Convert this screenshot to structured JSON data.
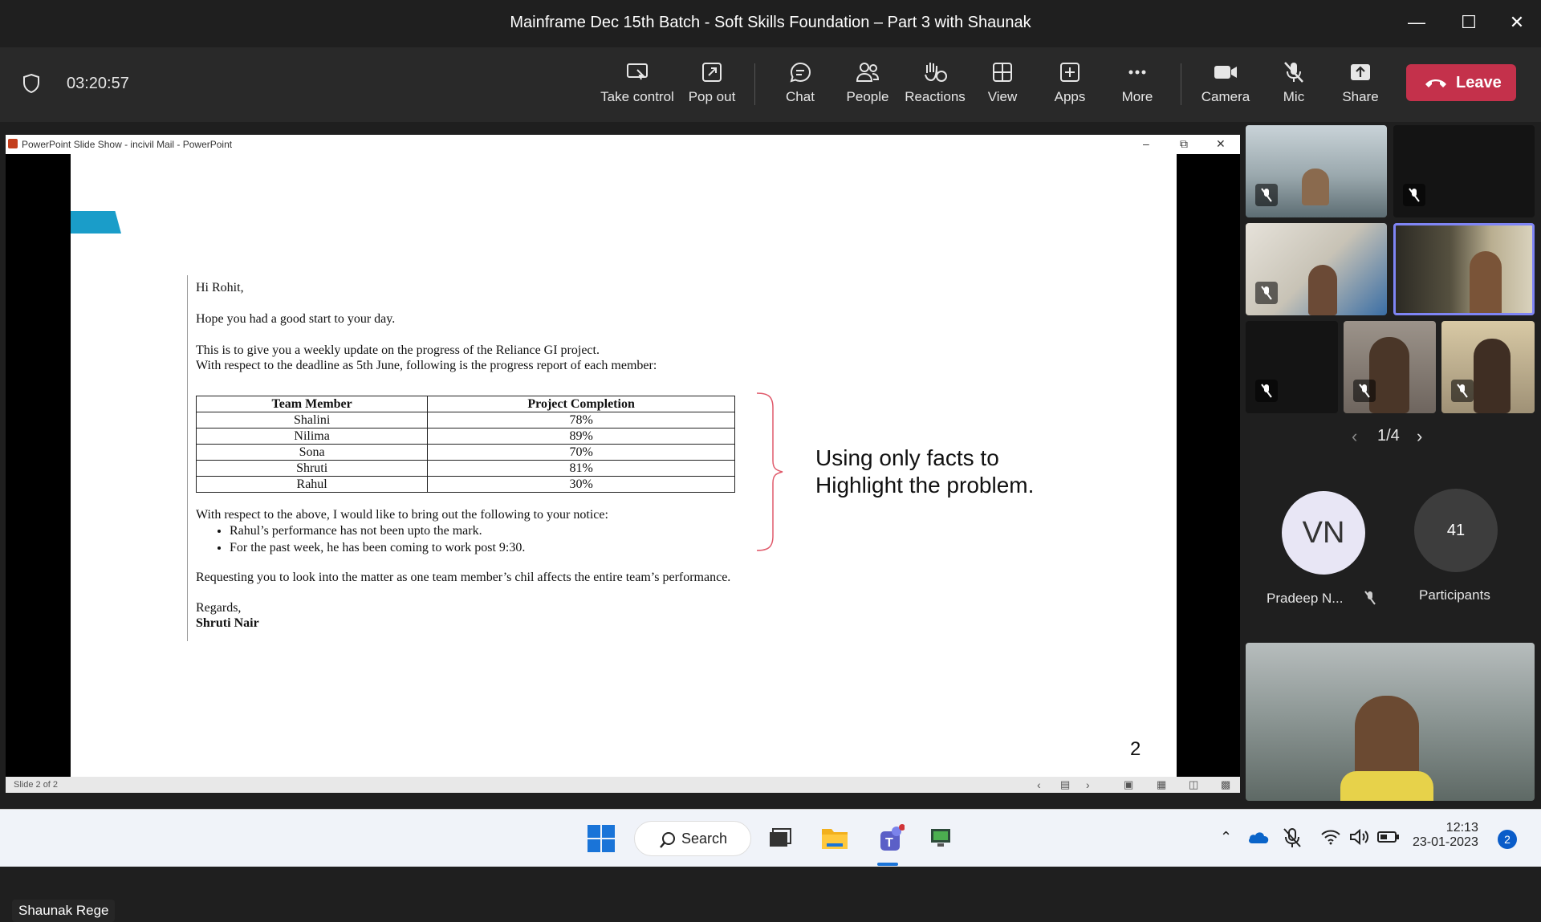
{
  "window": {
    "title": "Mainframe Dec 15th Batch - Soft Skills Foundation – Part 3 with  Shaunak"
  },
  "meeting": {
    "timer": "03:20:57",
    "controls": {
      "take_control": "Take control",
      "pop_out": "Pop out",
      "chat": "Chat",
      "people": "People",
      "reactions": "Reactions",
      "view": "View",
      "apps": "Apps",
      "more": "More",
      "camera": "Camera",
      "mic": "Mic",
      "share": "Share",
      "leave": "Leave"
    },
    "pager": "1/4",
    "spotlight_initials": "VN",
    "spotlight_name": "Pradeep N...",
    "participants_count": "41",
    "participants_label": "Participants",
    "presenter_name": "Shaunak Rege"
  },
  "powerpoint": {
    "window_title": "PowerPoint Slide Show  -  incivil Mail - PowerPoint",
    "status": "Slide 2 of 2"
  },
  "slide": {
    "greeting": "Hi Rohit,",
    "line1": "Hope you had a good start to your day.",
    "line2": "This is to give you a weekly update on the progress of the Reliance GI project.",
    "line3": "With respect to the deadline as 5th June, following is the progress report of each member:",
    "table": {
      "headers": [
        "Team Member",
        "Project Completion"
      ],
      "rows": [
        [
          "Shalini",
          "78%"
        ],
        [
          "Nilima",
          "89%"
        ],
        [
          "Sona",
          "70%"
        ],
        [
          "Shruti",
          "81%"
        ],
        [
          "Rahul",
          "30%"
        ]
      ]
    },
    "notice_intro": "With respect to the above, I would like to bring out the following to your notice:",
    "bullets": [
      "Rahul’s performance has not been upto the mark.",
      "For the past week, he has been coming to work post 9:30."
    ],
    "request": "Requesting you to look into the matter as one team member’s chil affects the entire team’s performance.",
    "regards": "Regards,",
    "signature": "Shruti Nair",
    "callout_line1": "Using only facts to",
    "callout_line2": "Highlight the problem.",
    "slide_number": "2"
  },
  "taskbar": {
    "search_label": "Search",
    "time": "12:13",
    "date": "23-01-2023",
    "notification_count": "2"
  }
}
